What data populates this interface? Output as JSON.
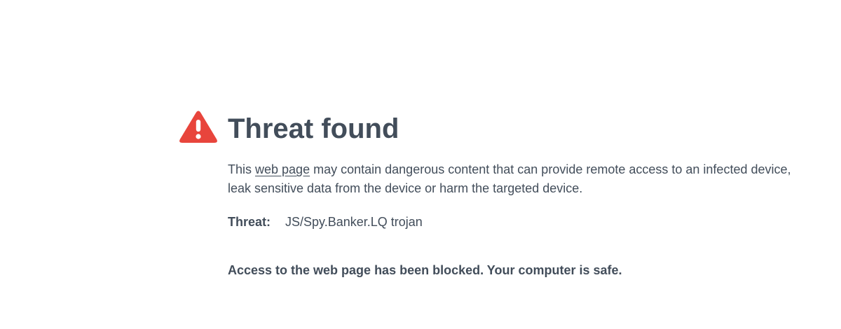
{
  "header": {
    "icon": "warning-triangle-icon",
    "icon_color": "#e8453c",
    "title": "Threat found"
  },
  "description": {
    "before_link": "This ",
    "link_text": "web page",
    "after_link_line1": " may contain dangerous content that can provide remote access to an infected device,",
    "line2": "leak sensitive data from the device or harm the targeted device."
  },
  "threat": {
    "label": "Threat:",
    "value": "JS/Spy.Banker.LQ trojan"
  },
  "status": {
    "message": "Access to the web page has been blocked. Your computer is safe."
  },
  "colors": {
    "text": "#424d5a",
    "background": "#ffffff"
  }
}
